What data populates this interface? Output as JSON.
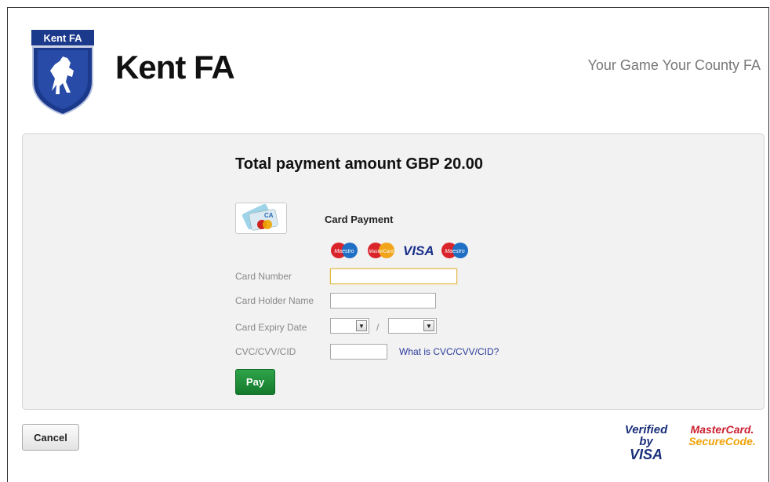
{
  "header": {
    "crest_label": "Kent FA",
    "brand_title": "Kent FA",
    "tagline": "Your Game Your County FA"
  },
  "payment": {
    "total_text": "Total payment amount GBP 20.00",
    "method_label": "Card Payment",
    "card_brands": [
      "Maestro",
      "MasterCard",
      "VISA",
      "Maestro"
    ],
    "fields": {
      "card_number_label": "Card Number",
      "card_number_value": "",
      "holder_name_label": "Card Holder Name",
      "holder_name_value": "",
      "expiry_label": "Card Expiry Date",
      "expiry_month": "",
      "expiry_year": "",
      "expiry_separator": "/",
      "cvc_label": "CVC/CVV/CID",
      "cvc_value": "",
      "cvc_help_link": "What is CVC/CVV/CID?"
    },
    "pay_label": "Pay"
  },
  "footer": {
    "cancel_label": "Cancel",
    "verified_by": "Verified by",
    "visa": "VISA",
    "mastercard": "MasterCard.",
    "securecode": "SecureCode."
  },
  "colors": {
    "pay_button": "#1e8f3b",
    "link": "#2a3a9a",
    "crest_blue": "#1c3a8c"
  }
}
